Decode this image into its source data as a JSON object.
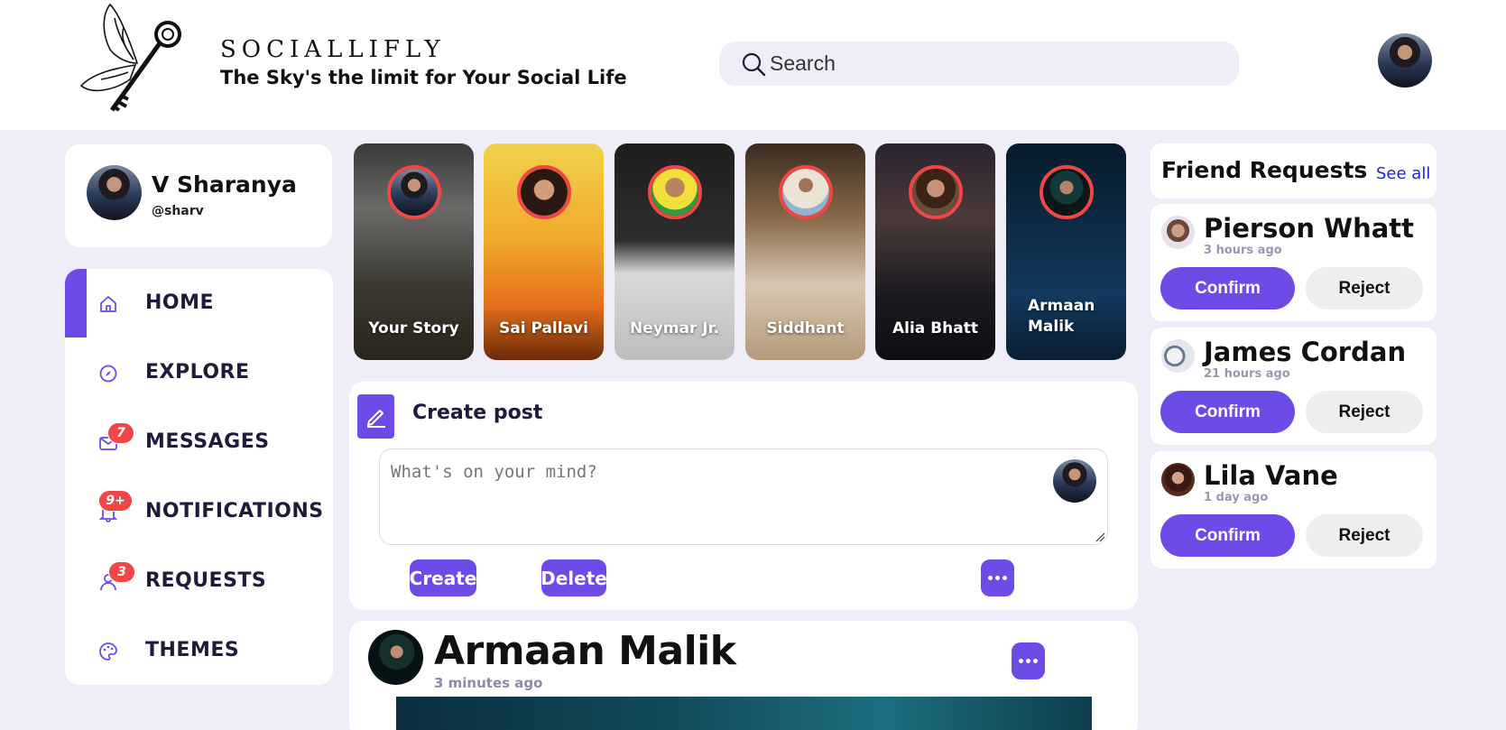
{
  "brand": {
    "name": "SOCIALLIFLY",
    "tagline": "The Sky's the limit for Your Social Life"
  },
  "search": {
    "placeholder": "Search"
  },
  "profile": {
    "name": "V Sharanya",
    "handle": "@sharv"
  },
  "nav": [
    {
      "label": "HOME",
      "icon": "home-icon",
      "active": true
    },
    {
      "label": "EXPLORE",
      "icon": "compass-icon"
    },
    {
      "label": "MESSAGES",
      "icon": "mail-icon",
      "badge": "7"
    },
    {
      "label": "NOTIFICATIONS",
      "icon": "bell-icon",
      "badge": "9+"
    },
    {
      "label": "REQUESTS",
      "icon": "user-icon",
      "badge": "3"
    },
    {
      "label": "THEMES",
      "icon": "palette-icon"
    }
  ],
  "stories": [
    {
      "name": "Your Story"
    },
    {
      "name": "Sai Pallavi"
    },
    {
      "name": "Neymar Jr."
    },
    {
      "name": "Siddhant"
    },
    {
      "name": "Alia Bhatt"
    },
    {
      "name": "Armaan Malik"
    }
  ],
  "create_post": {
    "title": "Create post",
    "placeholder": "What's on your mind?",
    "create_label": "Create",
    "delete_label": "Delete"
  },
  "post": {
    "author": "Armaan Malik",
    "time": "3 minutes ago"
  },
  "friend_requests": {
    "title": "Friend Requests",
    "see_all": "See all",
    "items": [
      {
        "name": "Pierson Whatt",
        "time": "3 hours ago",
        "confirm": "Confirm",
        "reject": "Reject"
      },
      {
        "name": "James Cordan",
        "time": "21 hours ago",
        "confirm": "Confirm",
        "reject": "Reject"
      },
      {
        "name": "Lila Vane",
        "time": "1 day ago",
        "confirm": "Confirm",
        "reject": "Reject"
      }
    ]
  },
  "colors": {
    "accent": "#6c4be6",
    "badge": "#f04646",
    "background": "#efedf8"
  }
}
